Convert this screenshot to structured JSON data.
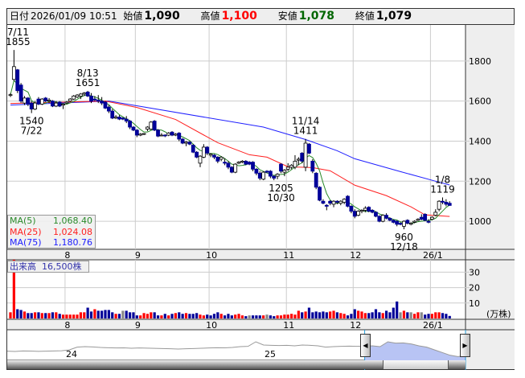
{
  "header": {
    "date_label": "日付",
    "date_value": "2026/01/09 10:51",
    "open_label": "始値",
    "open_value": "1,090",
    "high_label": "高値",
    "high_value": "1,100",
    "low_label": "安値",
    "low_value": "1,078",
    "close_label": "終値",
    "close_value": "1,079"
  },
  "legend": {
    "ma5_label": "MA(5)",
    "ma5_value": "1,068.40",
    "ma25_label": "MA(25)",
    "ma25_value": "1,024.08",
    "ma75_label": "MA(75)",
    "ma75_value": "1,180.76"
  },
  "volume_legend": {
    "label": "出来高",
    "value": "16,500株"
  },
  "colors": {
    "up_body": "#ffffff",
    "down_body": "#000099",
    "ma5": "#2a8a2a",
    "ma25": "#ff2020",
    "ma75": "#2020ff",
    "vol_up": "#ff0000",
    "vol_down": "#000099",
    "vol_flat": "#888888",
    "nav_fill": "#b8c4f4"
  },
  "chart_data": {
    "type": "candlestick",
    "price_axis": {
      "ticks": [
        "1800",
        "1600",
        "1400",
        "1200",
        "1000"
      ],
      "tick_values": [
        1800,
        1600,
        1400,
        1200,
        1000
      ],
      "range": [
        860,
        1980
      ]
    },
    "month_labels": [
      {
        "label": "8",
        "day": 16
      },
      {
        "label": "9",
        "day": 36
      },
      {
        "label": "10",
        "day": 57
      },
      {
        "label": "11",
        "day": 79
      },
      {
        "label": "12",
        "day": 98
      },
      {
        "label": "26/1",
        "day": 120
      }
    ],
    "annotations": [
      {
        "lines": [
          "7/11",
          "1855"
        ],
        "day": 1,
        "price": 1855,
        "pos": "above"
      },
      {
        "lines": [
          "1540",
          "7/22"
        ],
        "day": 6,
        "price": 1540,
        "pos": "below"
      },
      {
        "lines": [
          "8/13",
          "1651"
        ],
        "day": 22,
        "price": 1651,
        "pos": "above"
      },
      {
        "lines": [
          "1205",
          "10/30"
        ],
        "day": 77,
        "price": 1205,
        "pos": "below"
      },
      {
        "lines": [
          "11/14",
          "1411"
        ],
        "day": 84,
        "price": 1411,
        "pos": "above"
      },
      {
        "lines": [
          "960",
          "12/18"
        ],
        "day": 112,
        "price": 960,
        "pos": "below"
      },
      {
        "lines": [
          "1/8",
          "1119"
        ],
        "day": 123,
        "price": 1119,
        "pos": "above"
      }
    ],
    "ohlc": [
      [
        1630,
        1640,
        1620,
        1632
      ],
      [
        1708,
        1855,
        1700,
        1772
      ],
      [
        1756,
        1760,
        1640,
        1652
      ],
      [
        1680,
        1690,
        1590,
        1600
      ],
      [
        1590,
        1625,
        1580,
        1615
      ],
      [
        1615,
        1620,
        1575,
        1585
      ],
      [
        1590,
        1600,
        1540,
        1560
      ],
      [
        1560,
        1600,
        1555,
        1590
      ],
      [
        1610,
        1620,
        1580,
        1585
      ],
      [
        1585,
        1615,
        1580,
        1610
      ],
      [
        1615,
        1620,
        1595,
        1600
      ],
      [
        1600,
        1615,
        1590,
        1605
      ],
      [
        1600,
        1605,
        1570,
        1575
      ],
      [
        1575,
        1600,
        1570,
        1590
      ],
      [
        1595,
        1600,
        1570,
        1575
      ],
      [
        1580,
        1590,
        1560,
        1585
      ],
      [
        1590,
        1600,
        1585,
        1595
      ],
      [
        1600,
        1615,
        1595,
        1610
      ],
      [
        1610,
        1630,
        1605,
        1625
      ],
      [
        1620,
        1635,
        1615,
        1630
      ],
      [
        1625,
        1640,
        1610,
        1635
      ],
      [
        1635,
        1645,
        1625,
        1640
      ],
      [
        1645,
        1651,
        1620,
        1625
      ],
      [
        1625,
        1640,
        1590,
        1600
      ],
      [
        1610,
        1625,
        1600,
        1605
      ],
      [
        1605,
        1630,
        1590,
        1600
      ],
      [
        1600,
        1620,
        1580,
        1590
      ],
      [
        1595,
        1600,
        1560,
        1565
      ],
      [
        1570,
        1580,
        1540,
        1550
      ],
      [
        1550,
        1560,
        1510,
        1515
      ],
      [
        1515,
        1530,
        1510,
        1520
      ],
      [
        1520,
        1530,
        1505,
        1510
      ],
      [
        1515,
        1520,
        1505,
        1510
      ],
      [
        1510,
        1525,
        1490,
        1500
      ],
      [
        1500,
        1505,
        1460,
        1470
      ],
      [
        1470,
        1475,
        1450,
        1455
      ],
      [
        1455,
        1460,
        1420,
        1430
      ],
      [
        1430,
        1440,
        1425,
        1435
      ],
      [
        1435,
        1440,
        1430,
        1438
      ],
      [
        1460,
        1475,
        1450,
        1470
      ],
      [
        1460,
        1500,
        1455,
        1495
      ],
      [
        1500,
        1505,
        1450,
        1455
      ],
      [
        1455,
        1460,
        1420,
        1425
      ],
      [
        1430,
        1440,
        1425,
        1430
      ],
      [
        1430,
        1435,
        1420,
        1428
      ],
      [
        1430,
        1445,
        1425,
        1440
      ],
      [
        1445,
        1450,
        1425,
        1430
      ],
      [
        1430,
        1440,
        1425,
        1435
      ],
      [
        1440,
        1445,
        1400,
        1410
      ],
      [
        1410,
        1415,
        1385,
        1390
      ],
      [
        1390,
        1400,
        1375,
        1395
      ],
      [
        1395,
        1400,
        1380,
        1385
      ],
      [
        1380,
        1385,
        1340,
        1345
      ],
      [
        1345,
        1350,
        1315,
        1320
      ],
      [
        1290,
        1330,
        1270,
        1325
      ],
      [
        1320,
        1385,
        1315,
        1370
      ],
      [
        1370,
        1375,
        1330,
        1340
      ],
      [
        1330,
        1340,
        1320,
        1335
      ],
      [
        1330,
        1335,
        1310,
        1320
      ],
      [
        1320,
        1325,
        1290,
        1300
      ],
      [
        1310,
        1325,
        1300,
        1320
      ],
      [
        1295,
        1315,
        1280,
        1290
      ],
      [
        1290,
        1300,
        1260,
        1270
      ],
      [
        1270,
        1275,
        1240,
        1245
      ],
      [
        1245,
        1290,
        1240,
        1285
      ],
      [
        1290,
        1300,
        1285,
        1295
      ],
      [
        1295,
        1305,
        1290,
        1300
      ],
      [
        1300,
        1305,
        1280,
        1285
      ],
      [
        1295,
        1300,
        1280,
        1285
      ],
      [
        1295,
        1300,
        1250,
        1260
      ],
      [
        1260,
        1265,
        1230,
        1240
      ],
      [
        1240,
        1250,
        1205,
        1215
      ],
      [
        1210,
        1250,
        1205,
        1245
      ],
      [
        1250,
        1255,
        1240,
        1245
      ],
      [
        1250,
        1255,
        1215,
        1225
      ],
      [
        1225,
        1230,
        1205,
        1215
      ],
      [
        1225,
        1240,
        1210,
        1235
      ],
      [
        1285,
        1290,
        1240,
        1250
      ],
      [
        1245,
        1260,
        1225,
        1255
      ],
      [
        1260,
        1290,
        1250,
        1270
      ],
      [
        1270,
        1285,
        1260,
        1280
      ],
      [
        1270,
        1330,
        1260,
        1300
      ],
      [
        1305,
        1320,
        1280,
        1310
      ],
      [
        1340,
        1345,
        1290,
        1300
      ],
      [
        1270,
        1411,
        1250,
        1390
      ],
      [
        1385,
        1390,
        1335,
        1340
      ],
      [
        1300,
        1310,
        1240,
        1250
      ],
      [
        1240,
        1245,
        1160,
        1170
      ],
      [
        1170,
        1175,
        1100,
        1105
      ],
      [
        1100,
        1110,
        1085,
        1090
      ],
      [
        1080,
        1085,
        1055,
        1075
      ],
      [
        1100,
        1105,
        1080,
        1090
      ],
      [
        1085,
        1105,
        1070,
        1100
      ],
      [
        1100,
        1105,
        1085,
        1095
      ],
      [
        1090,
        1105,
        1080,
        1100
      ],
      [
        1095,
        1115,
        1085,
        1110
      ],
      [
        1125,
        1130,
        1070,
        1075
      ],
      [
        1075,
        1080,
        1040,
        1050
      ],
      [
        1050,
        1060,
        1015,
        1025
      ],
      [
        1030,
        1055,
        1025,
        1050
      ],
      [
        1050,
        1060,
        1040,
        1055
      ],
      [
        1055,
        1075,
        1045,
        1065
      ],
      [
        1070,
        1075,
        1045,
        1050
      ],
      [
        1055,
        1060,
        1040,
        1045
      ],
      [
        1045,
        1050,
        1020,
        1025
      ],
      [
        1025,
        1030,
        995,
        1000
      ],
      [
        1000,
        1035,
        995,
        1030
      ],
      [
        1030,
        1040,
        1010,
        1015
      ],
      [
        1015,
        1020,
        1000,
        1005
      ],
      [
        1005,
        1010,
        990,
        995
      ],
      [
        1000,
        1005,
        975,
        985
      ],
      [
        990,
        995,
        980,
        985
      ],
      [
        975,
        1005,
        960,
        1000
      ],
      [
        1005,
        1010,
        985,
        990
      ],
      [
        985,
        995,
        980,
        990
      ],
      [
        995,
        1005,
        990,
        1000
      ],
      [
        1005,
        1015,
        1000,
        1010
      ],
      [
        1020,
        1035,
        1005,
        1010
      ],
      [
        1035,
        1040,
        1000,
        1005
      ],
      [
        1000,
        1010,
        990,
        995
      ],
      [
        1010,
        1025,
        1005,
        1020
      ],
      [
        1030,
        1060,
        1025,
        1045
      ],
      [
        1060,
        1105,
        1050,
        1100
      ],
      [
        1100,
        1119,
        1085,
        1095
      ],
      [
        1095,
        1110,
        1075,
        1085
      ],
      [
        1090,
        1100,
        1078,
        1079
      ]
    ],
    "ma25_points": [
      [
        0,
        1588
      ],
      [
        27,
        1600
      ],
      [
        36,
        1568
      ],
      [
        47,
        1508
      ],
      [
        59,
        1392
      ],
      [
        68,
        1332
      ],
      [
        73,
        1320
      ],
      [
        79,
        1272
      ],
      [
        86,
        1268
      ],
      [
        91,
        1252
      ],
      [
        98,
        1180
      ],
      [
        107,
        1128
      ],
      [
        114,
        1072
      ],
      [
        118,
        1032
      ],
      [
        125,
        1024
      ]
    ],
    "ma75_points": [
      [
        0,
        1580
      ],
      [
        28,
        1600
      ],
      [
        72,
        1470
      ],
      [
        84,
        1408
      ],
      [
        93,
        1352
      ],
      [
        98,
        1312
      ],
      [
        111,
        1248
      ],
      [
        121,
        1200
      ],
      [
        125,
        1181
      ]
    ],
    "volume_axis": {
      "ticks": [
        "30",
        "20",
        "10"
      ],
      "tick_values": [
        30,
        20,
        10
      ],
      "unit": "(万株)",
      "range": [
        0,
        38
      ]
    },
    "volume": [
      4,
      40,
      6,
      5.5,
      4.5,
      3.5,
      3.5,
      4,
      4,
      3.5,
      3.5,
      3.5,
      4,
      4,
      3,
      2.5,
      2.5,
      2.5,
      2.5,
      2.5,
      4,
      4,
      7,
      4.5,
      6,
      5,
      5,
      5.5,
      5.5,
      4,
      3,
      3,
      5,
      5,
      4,
      4,
      2,
      2,
      3.5,
      3,
      4,
      4,
      2,
      2,
      3,
      2,
      3,
      3.5,
      4,
      3,
      3.5,
      3,
      3,
      3.5,
      2.5,
      2,
      2.5,
      2,
      3,
      4,
      3,
      2,
      3,
      2,
      2.5,
      3,
      2,
      1.5,
      2,
      2,
      2,
      2,
      2,
      2.5,
      2,
      1.5,
      2,
      2,
      2.5,
      2.5,
      3,
      2.5,
      5,
      4,
      4.5,
      7,
      4,
      4.5,
      4,
      4.5,
      4,
      4.5,
      5,
      4,
      3.5,
      3,
      2,
      3,
      6,
      5,
      4.5,
      3.5,
      3.5,
      4,
      6,
      4,
      3.5,
      5,
      4,
      7,
      11,
      4,
      5,
      4,
      4,
      3,
      4,
      4,
      2.5,
      3,
      3,
      4,
      4,
      3.5,
      3,
      1.65
    ],
    "navigator": {
      "year_labels": [
        "24",
        "25"
      ],
      "values": [
        1250,
        1240,
        1260,
        1255,
        1245,
        1250,
        1260,
        1265,
        1300,
        1400,
        1420,
        1410,
        1390,
        1380,
        1370,
        1375,
        1360,
        1370,
        1365,
        1355,
        1350,
        1340,
        1330,
        1340,
        1350,
        1360,
        1370,
        1380,
        1375,
        1390,
        1420,
        1430,
        1600,
        1480,
        1470,
        1460,
        1470,
        1450,
        1480,
        1470,
        1450,
        1400,
        1420,
        1430,
        1440,
        1430,
        1440,
        1450,
        1420,
        1600,
        1550,
        1560,
        1520,
        1450,
        1400,
        1300,
        1200,
        1100,
        1050,
        1080
      ],
      "selection_start_fraction": 0.78
    }
  }
}
